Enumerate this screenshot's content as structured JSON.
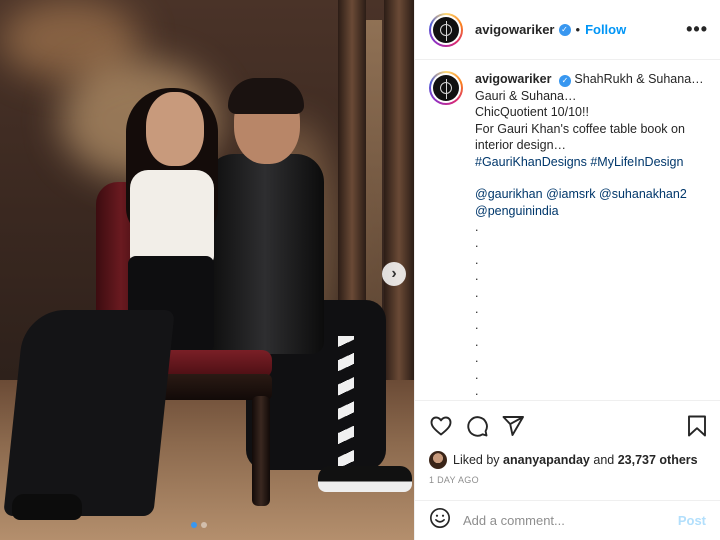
{
  "post": {
    "username": "avigowariker",
    "follow_label": "Follow",
    "separator": "•",
    "more_label": "•••",
    "verified_glyph": "✓"
  },
  "caption": {
    "username": "avigowariker",
    "lines": [
      "ShahRukh & Suhana…",
      "Gauri & Suhana…",
      "ChicQuotient 10/10!!",
      "For Gauri Khan's coffee table book on",
      "interior design…"
    ],
    "hashtags": "#GauriKhanDesigns #MyLifeInDesign",
    "mentions_line1": "@gaurikhan @iamsrk @suhanakhan2",
    "mentions_line2": "@penguinindia",
    "dots": [
      ".",
      ".",
      ".",
      ".",
      ".",
      ".",
      ".",
      ".",
      ".",
      ".",
      "."
    ]
  },
  "media": {
    "next_glyph": "›",
    "slide_count": 2,
    "active_slide": 1
  },
  "actions": {
    "like_icon": "heart-icon",
    "comment_icon": "comment-icon",
    "share_icon": "share-icon",
    "save_icon": "bookmark-icon"
  },
  "likes": {
    "prefix": "Liked by",
    "user": "ananyapanday",
    "middle": "and",
    "others": "23,737 others"
  },
  "timestamp": "1 DAY AGO",
  "comment_box": {
    "placeholder": "Add a comment...",
    "post_label": "Post",
    "emoji_icon": "smiley-icon"
  },
  "colors": {
    "link_blue": "#0095f6",
    "hashtag_navy": "#00376b",
    "post_disabled": "#b2dffc",
    "muted": "#8e8e8e"
  }
}
